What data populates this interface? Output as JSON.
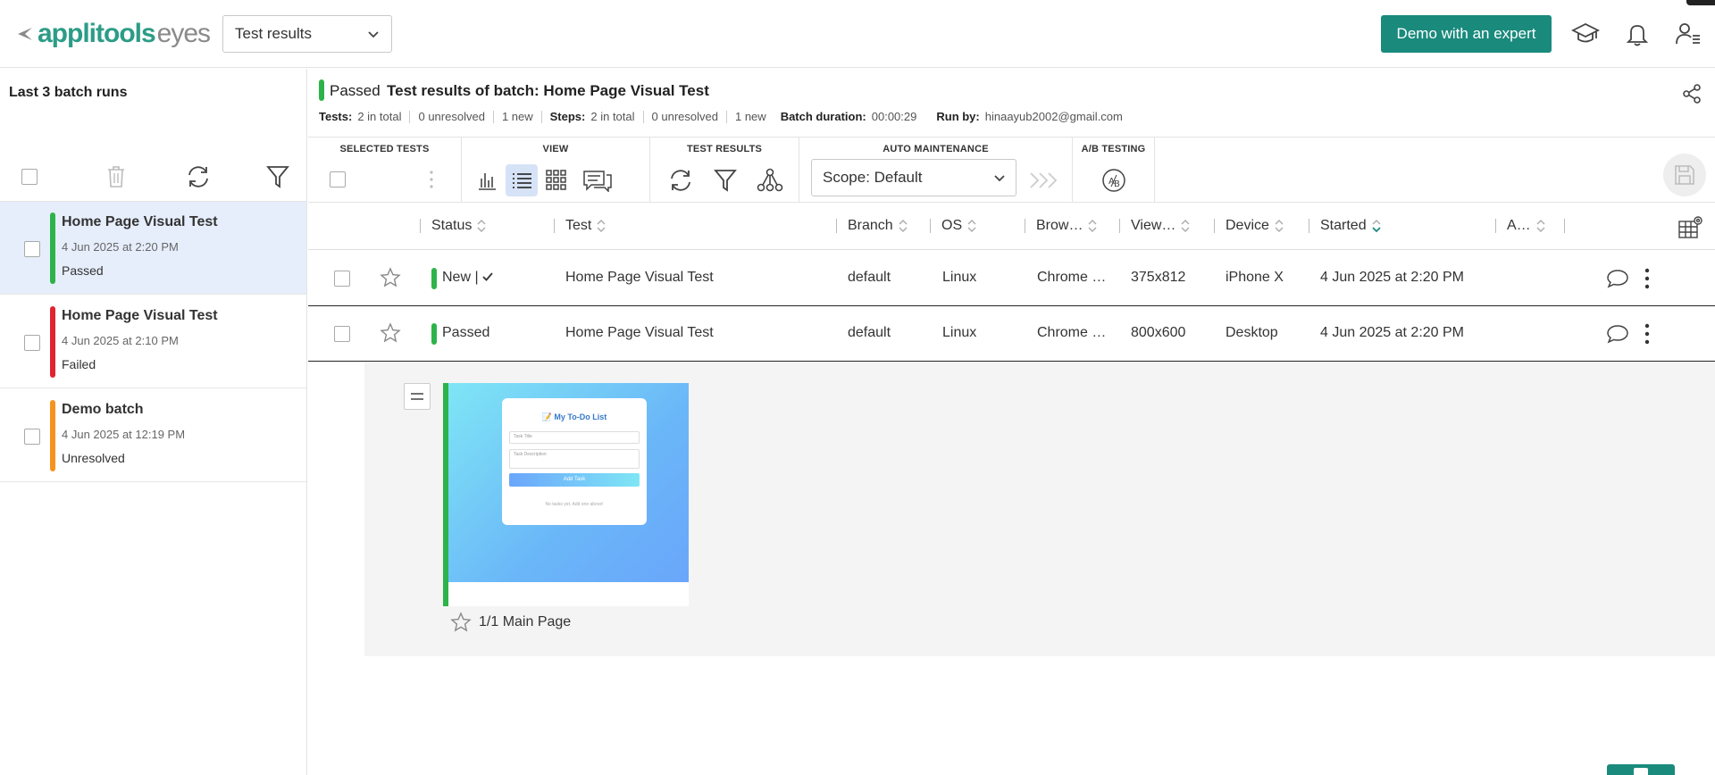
{
  "app": {
    "logo_main": "applitools",
    "logo_sub": "eyes"
  },
  "topbar": {
    "view_select": "Test results",
    "demo_button": "Demo with an expert",
    "icons": [
      "graduation-cap-icon",
      "bell-icon",
      "user-menu-icon"
    ]
  },
  "sidebar": {
    "title": "Last 3 batch runs",
    "batches": [
      {
        "name": "Home Page Visual Test",
        "date": "4 Jun 2025 at 2:20 PM",
        "status": "Passed",
        "color": "#2db34a",
        "selected": true
      },
      {
        "name": "Home Page Visual Test",
        "date": "4 Jun 2025 at 2:10 PM",
        "status": "Failed",
        "color": "#e0242f",
        "selected": false
      },
      {
        "name": "Demo batch",
        "date": "4 Jun 2025 at 12:19 PM",
        "status": "Unresolved",
        "color": "#f5931f",
        "selected": false
      }
    ]
  },
  "header": {
    "status": "Passed",
    "title": "Test results of batch:  Home Page Visual Test",
    "stats": {
      "tests_label": "Tests:",
      "tests_total": "2 in total",
      "tests_unresolved": "0 unresolved",
      "tests_new": "1 new",
      "steps_label": "Steps:",
      "steps_total": "2 in total",
      "steps_unresolved": "0 unresolved",
      "steps_new": "1 new",
      "duration_label": "Batch duration:",
      "duration": "00:00:29",
      "runby_label": "Run by:",
      "runby": "hinaayub2002@gmail.com"
    }
  },
  "toolbar": {
    "selected_tests": "SELECTED TESTS",
    "view": "VIEW",
    "test_results": "TEST RESULTS",
    "auto_maintenance": "AUTO MAINTENANCE",
    "ab_testing": "A/B TESTING",
    "scope": "Scope: Default"
  },
  "table": {
    "columns": [
      "Status",
      "Test",
      "Branch",
      "OS",
      "Brow…",
      "View…",
      "Device",
      "Started",
      "A…"
    ],
    "rows": [
      {
        "status": "New |",
        "test": "Home Page Visual Test",
        "branch": "default",
        "os": "Linux",
        "browser": "Chrome …",
        "viewport": "375x812",
        "device": "iPhone X",
        "started": "4 Jun 2025 at 2:20 PM"
      },
      {
        "status": "Passed",
        "test": "Home Page Visual Test",
        "branch": "default",
        "os": "Linux",
        "browser": "Chrome …",
        "viewport": "800x600",
        "device": "Desktop",
        "started": "4 Jun 2025 at 2:20 PM"
      }
    ]
  },
  "detail": {
    "caption": "1/1 Main Page",
    "thumbnail": {
      "title": "📝 My To-Do List",
      "input1": "Task Title",
      "input2": "Task Description",
      "button": "Add Task",
      "empty": "No tasks yet. Add one above!"
    }
  }
}
